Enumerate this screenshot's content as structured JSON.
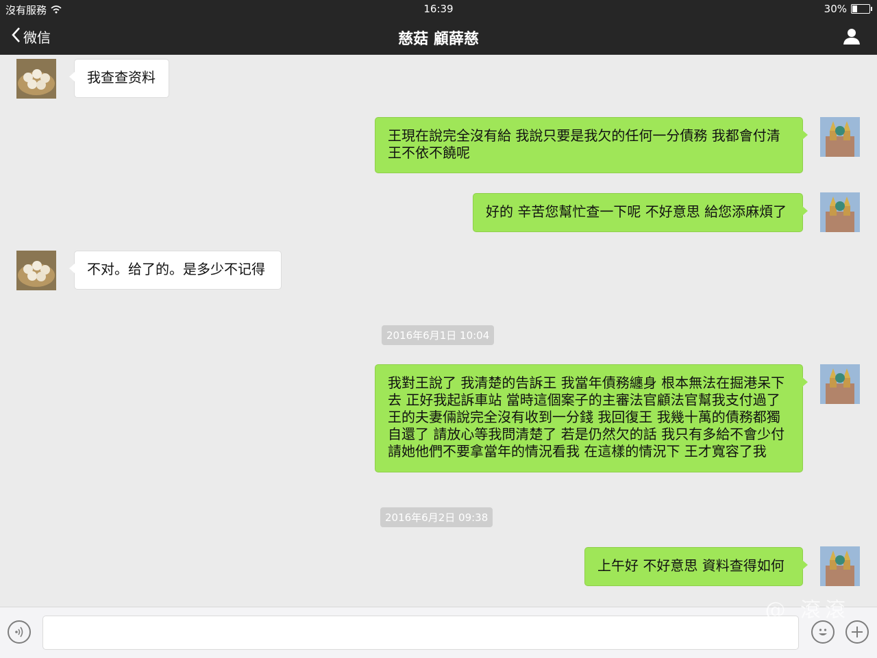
{
  "status_bar": {
    "carrier": "沒有服務",
    "time": "16:39",
    "battery": "30%",
    "battery_level": 0.3
  },
  "nav": {
    "back_label": "微信",
    "title": "慈菇 顧薛慈"
  },
  "messages": [
    {
      "side": "in",
      "text": "我查查资料"
    },
    {
      "side": "out",
      "lines": [
        "王現在說完全沒有給 我說只要是我欠的任何一分債務 我都會付清",
        "王不依不饒呢"
      ]
    },
    {
      "side": "out",
      "text": "好的 辛苦您幫忙查一下呢 不好意思 給您添麻煩了"
    },
    {
      "side": "in",
      "text": "不对。给了的。是多少不记得"
    },
    {
      "side": "timestamp",
      "text": "2016年6月1日 10:04"
    },
    {
      "side": "out",
      "lines": [
        "我對王說了 我清楚的告訴王 我當年債務纏身 根本無法在掘港呆下",
        "去 正好我起訴車站 當時這個案子的主審法官顧法官幫我支付過了",
        "王的夫妻倆說完全沒有收到一分錢 我回復王 我幾十萬的債務都獨",
        "自還了 請放心等我問清楚了 若是仍然欠的話 我只有多給不會少付",
        "請她他們不要拿當年的情況看我 在這樣的情況下 王才寬容了我"
      ]
    },
    {
      "side": "timestamp",
      "text": "2016年6月2日 09:38"
    },
    {
      "side": "out",
      "text": "上午好 不好意思 資料查得如何"
    }
  ],
  "watermark": "@ 滾滾",
  "colors": {
    "bar": "#262626",
    "out_bubble": "#9fe658",
    "in_bubble": "#ffffff",
    "background": "#ebebeb"
  }
}
